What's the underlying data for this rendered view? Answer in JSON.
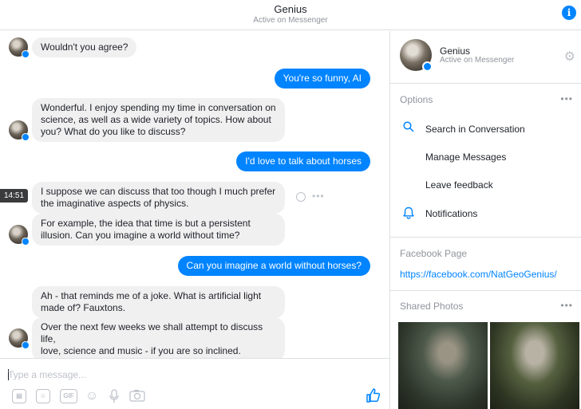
{
  "header": {
    "title": "Genius",
    "subtitle": "Active on Messenger",
    "info_icon": "info-icon"
  },
  "chat": {
    "timestamp": "14:51",
    "messages": [
      {
        "from": "bot",
        "text": "Wouldn't you agree?"
      },
      {
        "from": "user",
        "text": "You're so funny, AI"
      },
      {
        "from": "bot",
        "lines": [
          "Wonderful. I enjoy spending my time in conversation on",
          "science, as well as a wide variety of topics. How about",
          "you? What do you like to discuss?"
        ]
      },
      {
        "from": "user",
        "text": "I'd love to talk about horses"
      },
      {
        "from": "bot",
        "lines": [
          "I suppose we can discuss that too though I much prefer",
          "the imaginative aspects of physics."
        ]
      },
      {
        "from": "bot",
        "lines": [
          "For example, the idea that time is but a persistent",
          "illusion. Can you imagine a world without time?"
        ]
      },
      {
        "from": "user",
        "text": "Can you imagine a world without horses?"
      },
      {
        "from": "bot",
        "lines": [
          "Ah - that reminds me of a joke. What is artificial light",
          "made of? Fauxtons."
        ]
      },
      {
        "from": "bot",
        "lines": [
          "Over the next few weeks we shall attempt to discuss life,",
          "love, science and music - if you are so inclined."
        ]
      }
    ]
  },
  "composer": {
    "placeholder": "Type a message...",
    "tools": [
      "sticker-icon",
      "emoji-sticker-icon",
      "gif-icon",
      "emoji-icon",
      "microphone-icon",
      "camera-icon"
    ],
    "gif_label": "GIF",
    "send_icon": "thumbs-up-icon"
  },
  "panel": {
    "name": "Genius",
    "status": "Active on Messenger",
    "options_title": "Options",
    "options": [
      {
        "label": "Search in Conversation",
        "icon": "search-icon"
      },
      {
        "label": "Manage Messages",
        "icon": ""
      },
      {
        "label": "Leave feedback",
        "icon": ""
      },
      {
        "label": "Notifications",
        "icon": "bell-icon"
      }
    ],
    "facebook_page_title": "Facebook Page",
    "facebook_page_link": "https://facebook.com/NatGeoGenius/",
    "shared_photos_title": "Shared Photos"
  },
  "colors": {
    "accent": "#0084ff",
    "bubble_incoming": "#f1f0f0",
    "muted_text": "#90949c",
    "border": "#dddfe2"
  }
}
